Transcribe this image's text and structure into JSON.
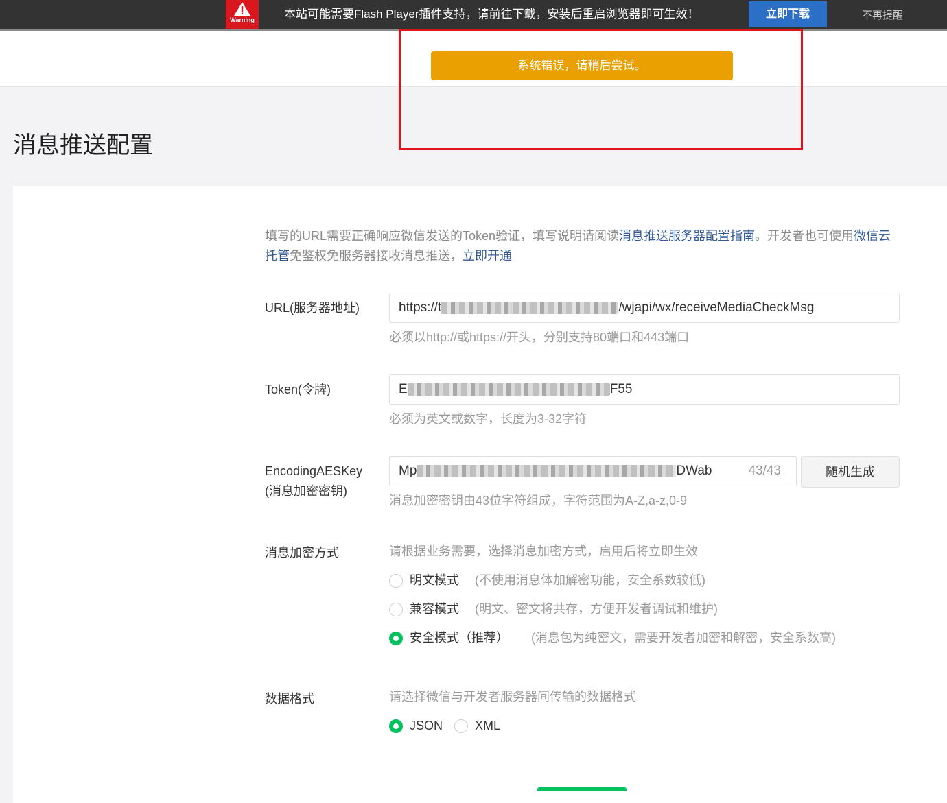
{
  "flash_banner": {
    "badge_text": "Warning",
    "message": "本站可能需要Flash Player插件支持，请前往下载，安装后重启浏览器即可生效！",
    "download_label": "立即下载",
    "dismiss_label": "不再提醒"
  },
  "toast": {
    "message": "系统错误，请稍后尝试。",
    "color": "#eaa000"
  },
  "highlight_color": "#e3131b",
  "page_title": "消息推送配置",
  "intro": {
    "text_1": "填写的URL需要正确响应微信发送的Token验证，填写说明请阅读",
    "link_guide": "消息推送服务器配置指南",
    "text_2": "。开发者也可使用",
    "link_cloud": "微信云托管",
    "text_3": "免鉴权免服务器接收消息推送，",
    "link_open": "立即开通"
  },
  "url_field": {
    "label": "URL(服务器地址)",
    "value_prefix": "https://t",
    "value_suffix": "/wjapi/wx/receiveMediaCheckMsg",
    "hint": "必须以http://或https://开头，分别支持80端口和443端口"
  },
  "token_field": {
    "label": "Token(令牌)",
    "value_prefix": "E",
    "value_suffix": "F55",
    "hint": "必须为英文或数字，长度为3-32字符"
  },
  "aes_field": {
    "label_line1": "EncodingAESKey",
    "label_line2": "(消息加密密钥)",
    "value_prefix": "Mp",
    "value_suffix": "DWab",
    "counter": "43/43",
    "generate_label": "随机生成",
    "hint": "消息加密密钥由43位字符组成，字符范围为A-Z,a-z,0-9"
  },
  "encryption": {
    "label": "消息加密方式",
    "hint": "请根据业务需要，选择消息加密方式，启用后将立即生效",
    "options": [
      {
        "label": "明文模式",
        "desc": "(不使用消息体加解密功能，安全系数较低)",
        "checked": false
      },
      {
        "label": "兼容模式",
        "desc": "(明文、密文将共存，方便开发者调试和维护)",
        "checked": false
      },
      {
        "label": "安全模式（推荐）",
        "desc": "(消息包为纯密文，需要开发者加密和解密，安全系数高)",
        "checked": true
      }
    ]
  },
  "data_format": {
    "label": "数据格式",
    "hint": "请选择微信与开发者服务器间传输的数据格式",
    "options": [
      {
        "label": "JSON",
        "checked": true
      },
      {
        "label": "XML",
        "checked": false
      }
    ]
  },
  "accent_color": "#07c160",
  "link_color": "#345b94"
}
